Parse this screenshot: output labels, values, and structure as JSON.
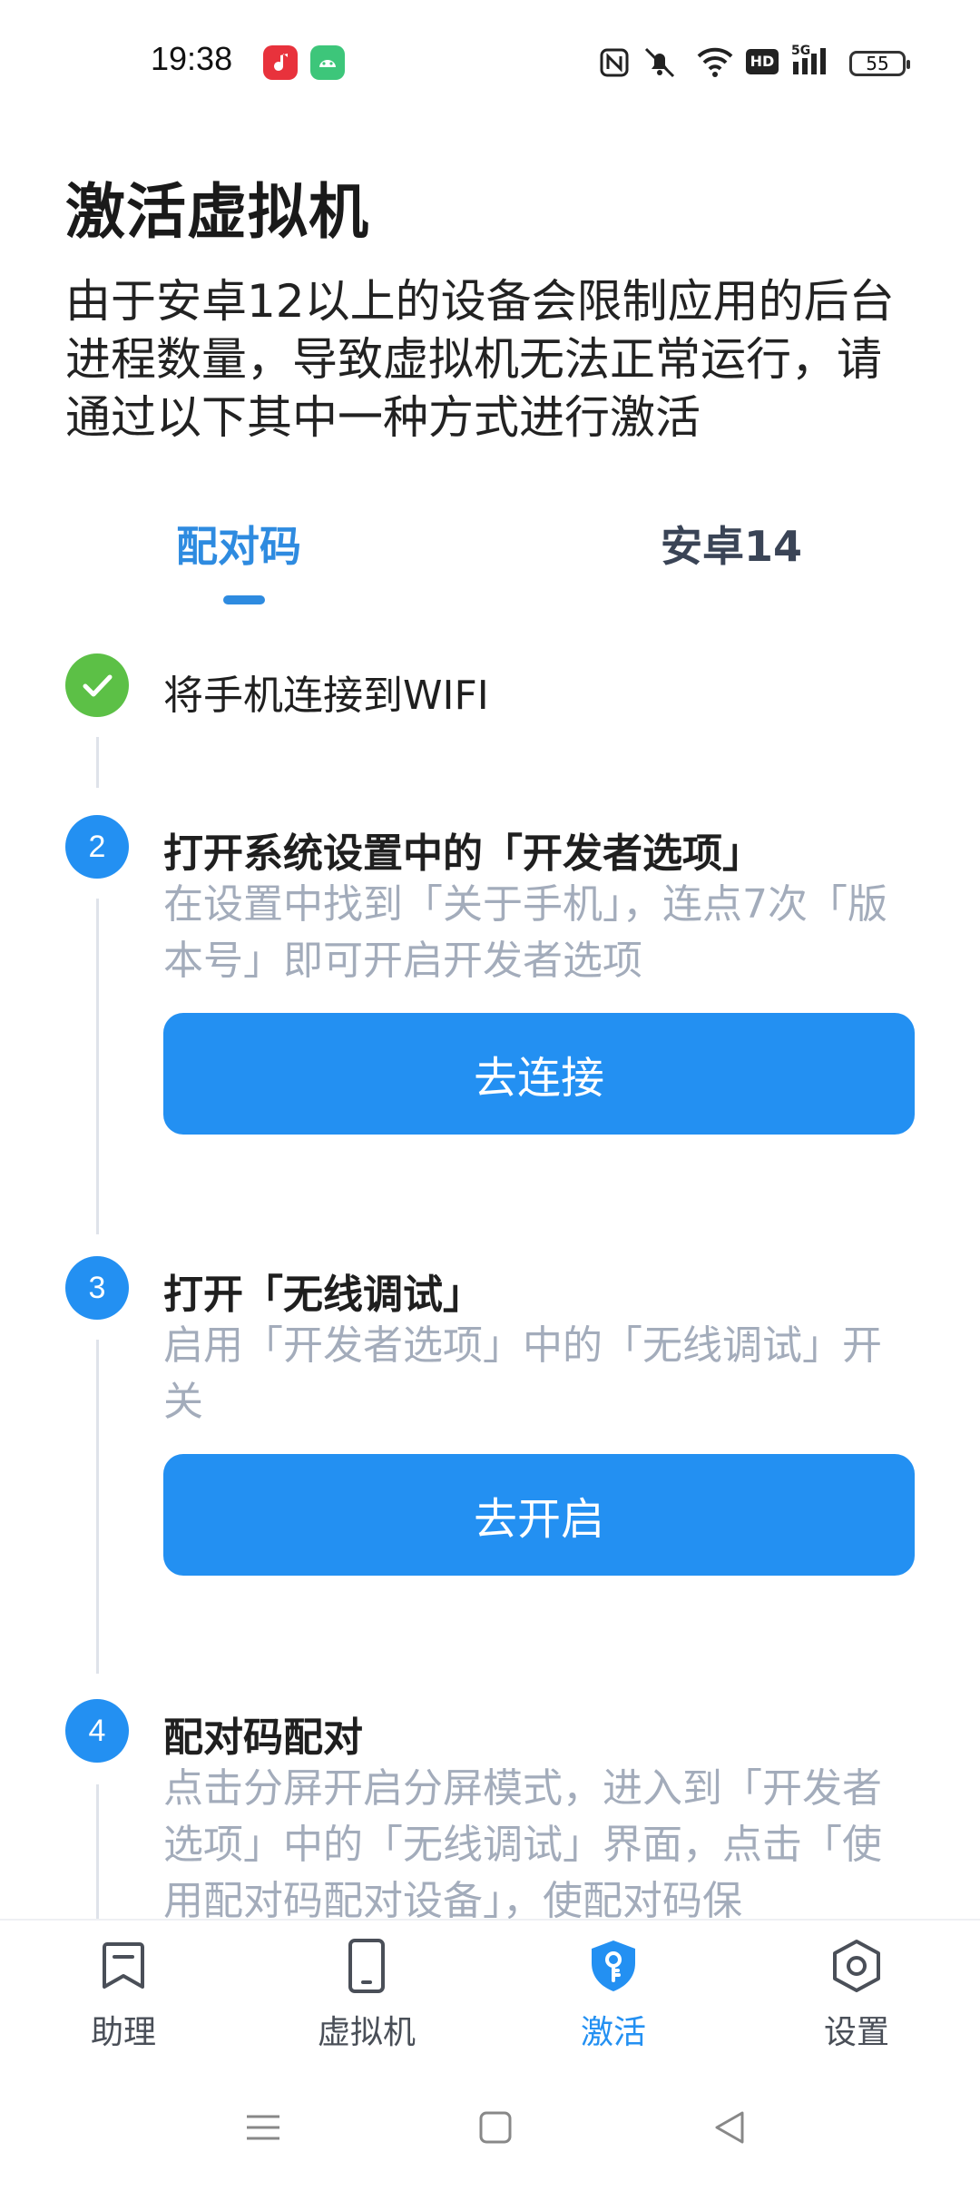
{
  "status_bar": {
    "time": "19:38",
    "battery": "55",
    "icons": [
      "music-app-icon",
      "android-app-icon",
      "nfc-icon",
      "mute-icon",
      "wifi-icon",
      "hd-icon",
      "5g-signal-icon",
      "battery-icon"
    ],
    "hd_label": "HD",
    "network_label": "5G"
  },
  "page": {
    "title": "激活虚拟机",
    "intro": "由于安卓12以上的设备会限制应用的后台进程数量，导致虚拟机无法正常运行，请通过以下其中一种方式进行激活"
  },
  "tabs": [
    {
      "label": "配对码",
      "active": true
    },
    {
      "label": "安卓14",
      "active": false
    }
  ],
  "steps": [
    {
      "badge": "",
      "title": "将手机连接到WIFI",
      "desc": "",
      "done": true
    },
    {
      "badge": "2",
      "title": "打开系统设置中的「开发者选项」",
      "desc": "在设置中找到「关于手机」，连点7次「版本号」即可开启开发者选项",
      "button": "去连接"
    },
    {
      "badge": "3",
      "title": "打开「无线调试」",
      "desc": "启用「开发者选项」中的「无线调试」开关",
      "button": "去开启"
    },
    {
      "badge": "4",
      "title": "配对码配对",
      "desc": "点击分屏开启分屏模式，进入到「开发者选项」中的「无线调试」界面，点击「使用配对码配对设备」，使配对码保"
    }
  ],
  "colors": {
    "accent": "#2390f2",
    "tab_accent": "#2e8be0",
    "done_green": "#5cc046",
    "muted_text": "#a3acbb"
  },
  "bottom_nav": [
    {
      "label": "助理",
      "icon": "bookmark-icon",
      "active": false
    },
    {
      "label": "虚拟机",
      "icon": "phone-icon",
      "active": false
    },
    {
      "label": "激活",
      "icon": "shield-key-icon",
      "active": true
    },
    {
      "label": "设置",
      "icon": "settings-hexagon-icon",
      "active": false
    }
  ],
  "system_nav": [
    "menu-icon",
    "home-icon",
    "back-icon"
  ]
}
